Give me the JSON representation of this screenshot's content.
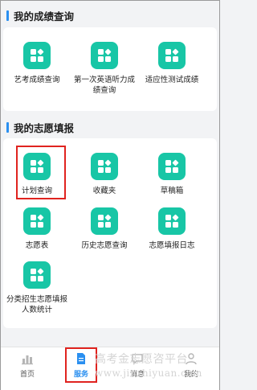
{
  "sections": {
    "scores": {
      "title": "我的成绩查询"
    },
    "volunteer": {
      "title": "我的志愿填报"
    }
  },
  "score_items": [
    {
      "label": "艺考成绩查询",
      "icon": "grid-app-icon"
    },
    {
      "label": "第一次英语听力成绩查询",
      "icon": "grid-app-icon"
    },
    {
      "label": "适应性测试成绩",
      "icon": "grid-app-icon"
    }
  ],
  "volunteer_items": [
    {
      "label": "计划查询",
      "icon": "grid-app-icon",
      "highlighted": true
    },
    {
      "label": "收藏夹",
      "icon": "grid-app-icon"
    },
    {
      "label": "草稿箱",
      "icon": "grid-app-icon"
    },
    {
      "label": "志愿表",
      "icon": "grid-app-icon"
    },
    {
      "label": "历史志愿查询",
      "icon": "grid-app-icon"
    },
    {
      "label": "志愿填报日志",
      "icon": "grid-app-icon"
    },
    {
      "label": "分类招生志愿填报人数统计",
      "icon": "grid-app-icon"
    }
  ],
  "bottom_nav": [
    {
      "label": "首页",
      "icon": "bar-chart-icon",
      "active": false
    },
    {
      "label": "服务",
      "icon": "document-icon",
      "active": true
    },
    {
      "label": "消息",
      "icon": "message-icon",
      "active": false
    },
    {
      "label": "我的",
      "icon": "user-icon",
      "active": false
    }
  ],
  "watermark": {
    "line1": "高考金志愿咨平台",
    "line2": "www.jinzhiyuan.com"
  },
  "colors": {
    "accent": "#2a8ff0",
    "tile": "#18c6a6",
    "highlight": "#e0231f",
    "background": "#f2f3f5"
  }
}
